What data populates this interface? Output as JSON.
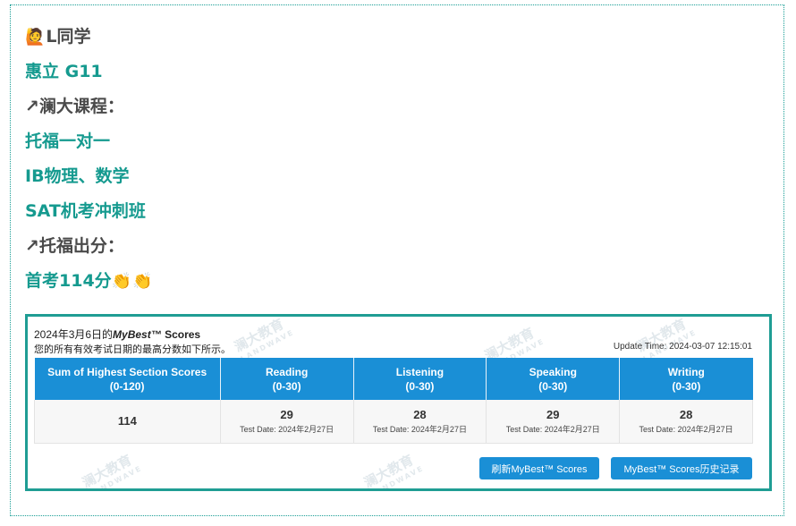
{
  "post": {
    "student_emoji": "🙋",
    "student": "L同学",
    "school": "惠立 G11",
    "arrow": "↗",
    "courses_label": "澜大课程：",
    "courses": [
      "托福一对一",
      "IB物理、数学",
      "SAT机考冲刺班"
    ],
    "result_label": "托福出分：",
    "result": "首考114分",
    "clap_emoji": "👏"
  },
  "card": {
    "title_prefix": "2024年3月6日的",
    "title_brand": "MyBest™",
    "title_suffix": " Scores",
    "subtitle": "您的所有有效考试日期的最高分数如下所示。",
    "update_time": "Update Time: 2024-03-07 12:15:01",
    "watermark_main": "澜大教育",
    "watermark_sub": "LANDWAVE",
    "headers": [
      {
        "name": "Sum of Highest Section Scores",
        "range": "(0-120)"
      },
      {
        "name": "Reading",
        "range": "(0-30)"
      },
      {
        "name": "Listening",
        "range": "(0-30)"
      },
      {
        "name": "Speaking",
        "range": "(0-30)"
      },
      {
        "name": "Writing",
        "range": "(0-30)"
      }
    ],
    "total": "114",
    "sections": [
      {
        "score": "29",
        "test_date": "Test Date: 2024年2月27日"
      },
      {
        "score": "28",
        "test_date": "Test Date: 2024年2月27日"
      },
      {
        "score": "29",
        "test_date": "Test Date: 2024年2月27日"
      },
      {
        "score": "28",
        "test_date": "Test Date: 2024年2月27日"
      }
    ],
    "buttons": {
      "refresh": "刷新MyBest™ Scores",
      "history": "MyBest™ Scores历史记录"
    }
  },
  "colors": {
    "teal": "#159a8f",
    "header_blue": "#1a8fd6",
    "frame": "#1a9e96"
  }
}
